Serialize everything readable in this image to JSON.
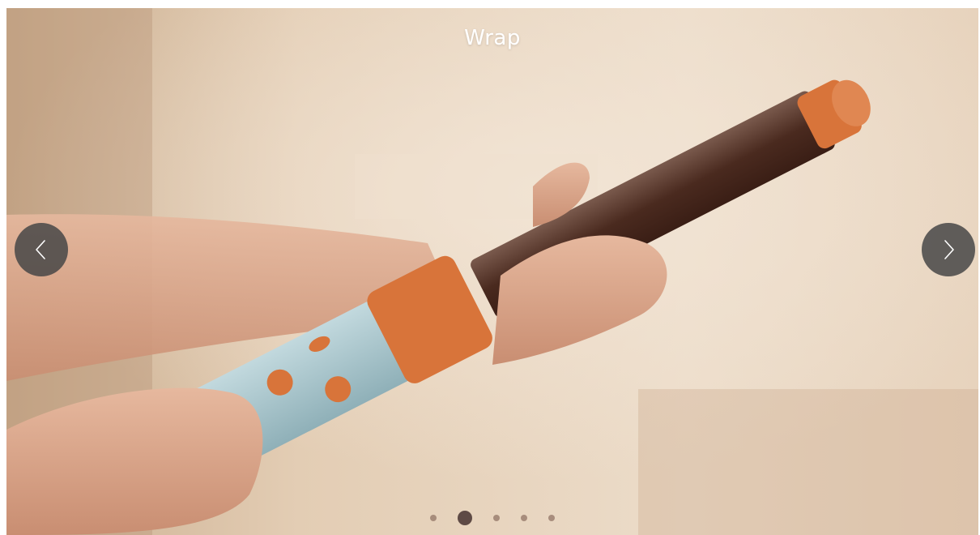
{
  "slide": {
    "title": "Wrap"
  },
  "carousel": {
    "slide_count": 5,
    "active_index": 1,
    "prev_icon": "chevron-left-icon",
    "next_icon": "chevron-right-icon"
  },
  "colors": {
    "nav_button": "#464646",
    "dot": "#8c6e5f",
    "dot_active": "#5e4a45",
    "barrel": "#4a2a1f",
    "accent_orange": "#d8743a",
    "handle_blue": "#a9c7cf"
  }
}
